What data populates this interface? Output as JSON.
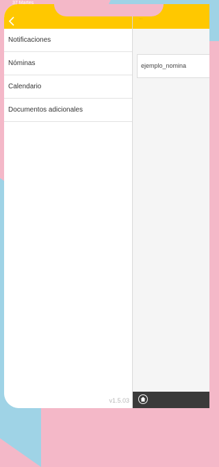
{
  "status_bar": {
    "text": "37  Martes"
  },
  "header": {
    "back_icon": "chevron-left-icon",
    "accent_color": "#ffc800"
  },
  "menu": {
    "items": [
      {
        "label": "Notificaciones"
      },
      {
        "label": "Nóminas"
      },
      {
        "label": "Calendario"
      },
      {
        "label": "Documentos adicionales"
      }
    ]
  },
  "version": "v1.5.03",
  "detail": {
    "header_title": "...",
    "documents": [
      {
        "name": "ejemplo_nomina"
      }
    ]
  },
  "tabbar": {
    "home_icon": "home-icon"
  }
}
